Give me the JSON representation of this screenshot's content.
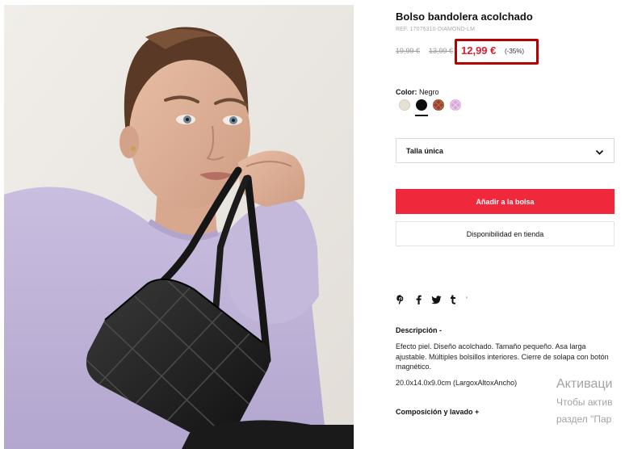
{
  "product": {
    "title": "Bolso bandolera acolchado",
    "ref": "REF. 17076310-DIAMOND-LM",
    "image_alt": "Modelo con jersey lila sosteniendo un bolso bandolera acolchado negro"
  },
  "prices": {
    "original": "19,99 €",
    "previous": "13,99 €",
    "current": "12,99 €",
    "discount": "(-35%)",
    "current_color": "#d81e2a",
    "highlight_color": "#b30000"
  },
  "color": {
    "label": "Color:",
    "selected": "Negro",
    "swatches": [
      {
        "name": "cream",
        "hex": "#e6e2d3"
      },
      {
        "name": "black",
        "hex": "#0c0c0c",
        "selected": true
      },
      {
        "name": "brown-quilted",
        "hex": "#8e4430"
      },
      {
        "name": "lilac-quilted",
        "hex": "#d7a6d8"
      }
    ]
  },
  "size": {
    "value": "Talla única",
    "icon": "chevron-down-icon"
  },
  "actions": {
    "add_to_bag": "Añadir a la bolsa",
    "add_to_bag_color": "#f0283c",
    "store_availability": "Disponibilidad en tienda"
  },
  "share": {
    "icons": [
      "pinterest-icon",
      "facebook-icon",
      "twitter-icon",
      "tumblr-icon"
    ],
    "more": "'"
  },
  "description": {
    "heading": "Descripción -",
    "text": "Efecto piel. Diseño acolchado. Tamaño pequeño. Asa larga ajustable. Múltiples bolsillos interiores. Cierre de solapa con botón magnético.",
    "dimensions": "20.0x14.0x9.0cm (LargoxAltoxAncho)"
  },
  "composition": {
    "heading": "Composición y lavado +"
  },
  "watermark": {
    "title": "Активаци",
    "line1": "Чтобы актив",
    "line2": "раздел \"Пар"
  }
}
